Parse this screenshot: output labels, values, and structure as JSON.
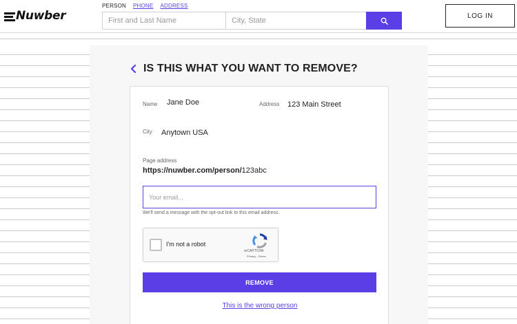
{
  "brand": {
    "name": "Nuwber"
  },
  "search": {
    "tabs": [
      {
        "label": "PERSON",
        "active": true
      },
      {
        "label": "PHONE",
        "active": false
      },
      {
        "label": "ADDRESS",
        "active": false
      }
    ],
    "name_placeholder": "First and Last Name",
    "city_placeholder": "City, State",
    "button_icon": "search-icon"
  },
  "header": {
    "login_label": "LOG IN"
  },
  "main": {
    "heading": "IS THIS WHAT YOU WANT TO REMOVE?",
    "back_icon": "chevron-left-icon",
    "record": {
      "name_label": "Name",
      "name_value": "Jane Doe",
      "address_label": "Address",
      "address_value": "123 Main Street",
      "city_label": "City",
      "city_value": "Anytown USA",
      "page_address_label": "Page address",
      "page_address_base": "https://nuwber.com/person/",
      "page_address_id": "123abc"
    },
    "email": {
      "placeholder": "Your email...",
      "value": "",
      "helper": "We'll send a message with the opt-out link to this email address."
    },
    "captcha": {
      "label": "I'm not a robot",
      "brand": "reCAPTCHA",
      "links": "Privacy - Terms",
      "checked": false
    },
    "remove_label": "REMOVE",
    "wrong_person_label": "This is the wrong person"
  },
  "colors": {
    "accent": "#5c3ee6",
    "text": "#222222",
    "panel_bg": "#f7f7f7"
  }
}
